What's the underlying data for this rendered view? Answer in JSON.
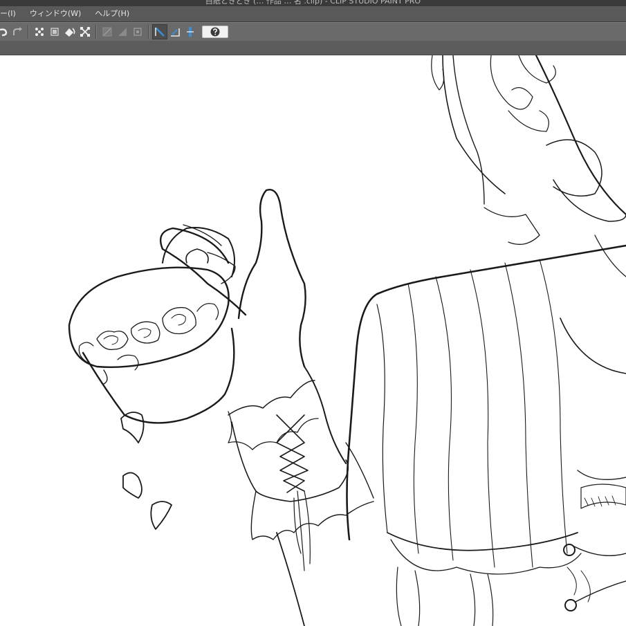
{
  "window": {
    "title": "白紙ときどき (… 作品 … 名 .clip) - CLIP STUDIO PAINT PRO"
  },
  "menubar": {
    "items": [
      {
        "label": "ー(I)"
      },
      {
        "label": "ウィンドウ(W)"
      },
      {
        "label": "ヘルプ(H)"
      }
    ]
  },
  "toolbar": {
    "icons": [
      "redo-icon",
      "transparent-area-selection-icon",
      "transform-icon",
      "fill-bucket-icon",
      "free-transform-icon",
      "ruler-disable-icon",
      "ruler-snap-icon",
      "special-ruler-icon",
      "snap-to-ruler-icon",
      "snap-to-special-ruler-icon",
      "snap-to-grid-icon",
      "help-icon"
    ]
  },
  "colors": {
    "menubar": "#595959",
    "toolbar": "#6a6a6a",
    "accent_blue": "#3a8fd9",
    "canvas": "#ffffff",
    "lineart": "#1a1a1a"
  }
}
